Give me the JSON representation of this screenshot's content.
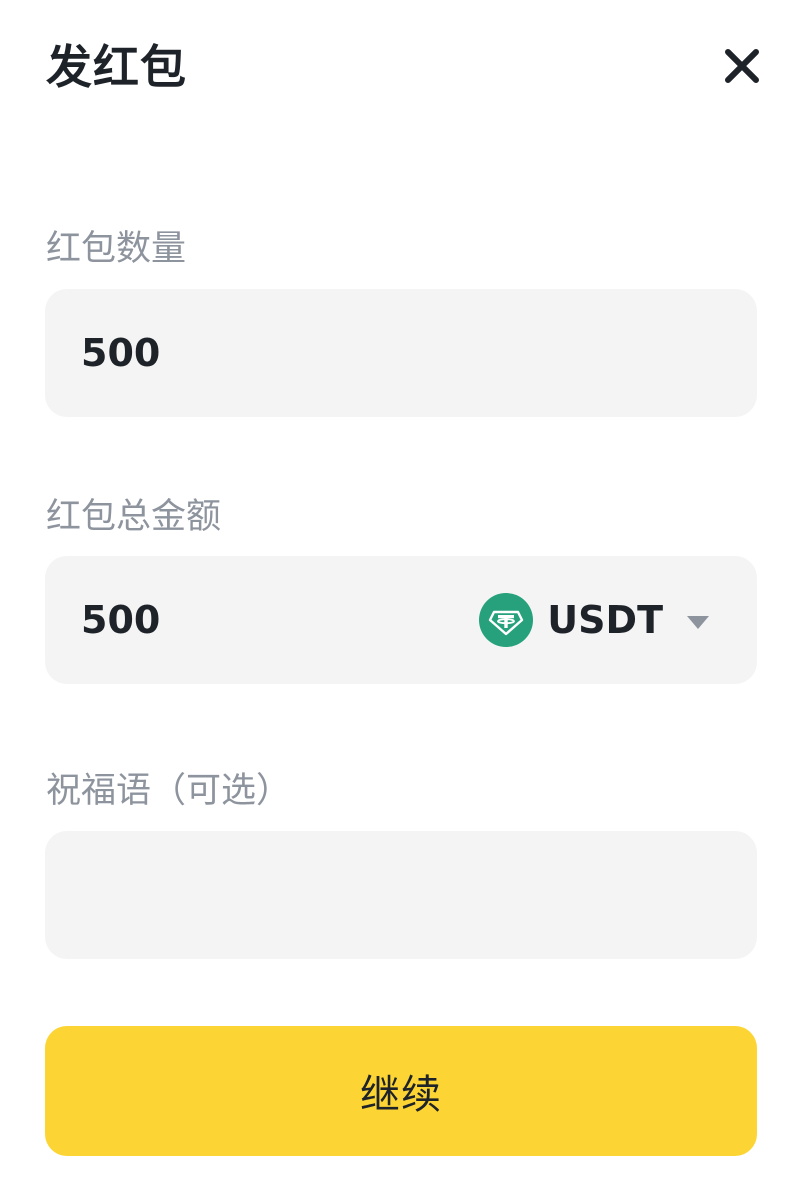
{
  "header": {
    "title": "发红包",
    "close_icon": "close-icon"
  },
  "fields": {
    "packet_count": {
      "label": "红包数量",
      "value": "500"
    },
    "total_amount": {
      "label": "红包总金额",
      "value": "500",
      "currency": {
        "symbol": "USDT",
        "icon": "tether-icon",
        "icon_color": "#26A17B"
      }
    },
    "greeting": {
      "label": "祝福语（可选）",
      "value": ""
    }
  },
  "actions": {
    "continue_label": "继续",
    "continue_color": "#FCD535"
  },
  "colors": {
    "field_bg": "#F4F4F4",
    "label_text": "#8E949E",
    "primary_text": "#1E2329"
  }
}
